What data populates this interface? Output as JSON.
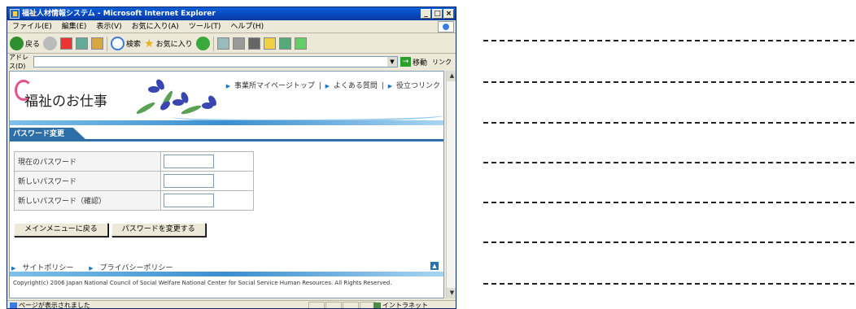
{
  "window": {
    "title": "福祉人材情報システム - Microsoft Internet Explorer",
    "controls": [
      "_",
      "□",
      "×"
    ]
  },
  "menu": [
    "ファイル(E)",
    "編集(E)",
    "表示(V)",
    "お気に入り(A)",
    "ツール(T)",
    "ヘルプ(H)"
  ],
  "toolbar": {
    "back_label": "戻る",
    "search_label": "検索",
    "favorites_label": "お気に入り"
  },
  "address": {
    "label": "アドレス(D)",
    "value": "",
    "go_label": "移動",
    "links_label": "リンク"
  },
  "page": {
    "logo_text": "福祉のお仕事",
    "top_links": [
      "事業所マイページトップ",
      "よくある質問",
      "役立つリンク"
    ],
    "section_title": "パスワード変更",
    "fields": [
      {
        "label": "現在のパスワード",
        "value": ""
      },
      {
        "label": "新しいパスワード",
        "value": ""
      },
      {
        "label": "新しいパスワード（確認）",
        "value": ""
      }
    ],
    "buttons": {
      "back_menu": "メインメニューに戻る",
      "change_password": "パスワードを変更する"
    },
    "footer_links": [
      "サイトポリシー",
      "プライバシーポリシー"
    ],
    "copyright": "Copyright(c) 2006 Japan National Council of Social Welfare National Center for Social Service Human Resources. All Rights Reserved."
  },
  "status": {
    "text": "ページが表示されました",
    "zone": "イントラネット"
  },
  "colors": {
    "accent": "#2e6fa8",
    "logo_pink": "#e8508a",
    "titlebar": "#0843b8"
  }
}
